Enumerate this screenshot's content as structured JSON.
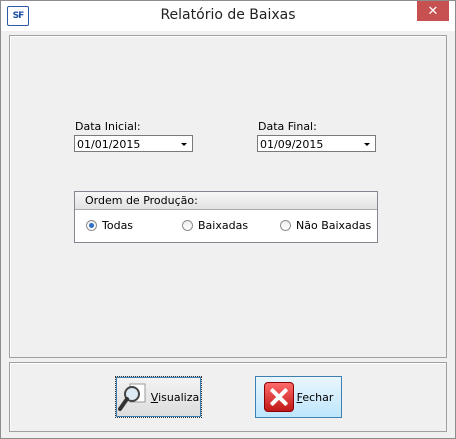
{
  "window": {
    "title": "Relatório de Baixas",
    "app_icon_text": "SF",
    "close_glyph": "✕"
  },
  "filters": {
    "start_date_label": "Data Inicial:",
    "start_date_value": "01/01/2015",
    "end_date_label": "Data Final:",
    "end_date_value": "01/09/2015"
  },
  "order_group": {
    "title": "Ordem de Produção:",
    "options": [
      {
        "label": "Todas",
        "selected": true
      },
      {
        "label": "Baixadas",
        "selected": false
      },
      {
        "label": "Não Baixadas",
        "selected": false
      }
    ]
  },
  "buttons": {
    "visualiza_accel": "V",
    "visualiza_rest": "isualiza",
    "fechar_accel": "F",
    "fechar_rest": "echar"
  },
  "icons": {
    "visualiza": "magnifier-icon",
    "fechar": "red-x-icon"
  }
}
